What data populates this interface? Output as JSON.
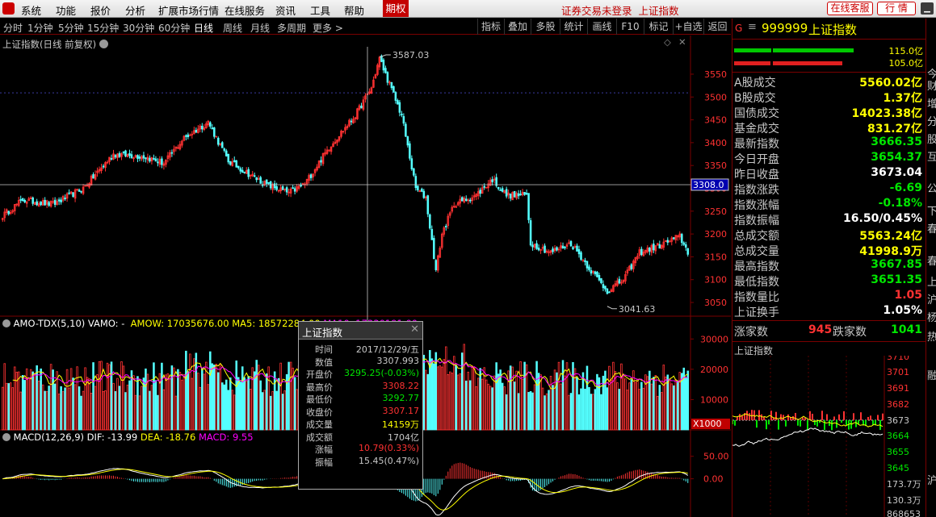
{
  "menu": {
    "items": [
      "系统",
      "功能",
      "报价",
      "分析",
      "扩展市场行情",
      "在线服务",
      "资讯",
      "工具",
      "帮助"
    ],
    "qihuo_tab": "期权",
    "login_status": "证券交易未登录",
    "current_index": "上证指数",
    "online_service_button": "在线客服",
    "quote_button": "行 情"
  },
  "periods": [
    "分时",
    "1分钟",
    "5分钟",
    "15分钟",
    "30分钟",
    "60分钟",
    "日线",
    "周线",
    "月线",
    "多周期",
    "更多"
  ],
  "active_period": "日线",
  "tools": [
    "指标",
    "叠加",
    "多股",
    "统计",
    "画线",
    "F10",
    "标记",
    "+自选",
    "返回"
  ],
  "main_panel": {
    "title": "上证指数(日线 前复权)",
    "high_label": "3587.03",
    "low_label": "3041.63",
    "crosshair_value": "3308.0"
  },
  "volume_panel": {
    "title": "AMO-TDX(5,10)",
    "vamo": "VAMO: -",
    "amow": "AMOW: 17035676.00",
    "ma5": "MA5: 18572284.00",
    "ma10": "MA10: 17330191.00",
    "unit": "X1000"
  },
  "macd_panel": {
    "title": "MACD(12,26,9)",
    "dif": "DIF: -13.99",
    "dea": "DEA: -18.76",
    "macd": "MACD: 9.55"
  },
  "tooltip": {
    "title": "上证指数",
    "rows": [
      {
        "k": "时间",
        "v": "2017/12/29/五",
        "c": "#c8c8c8"
      },
      {
        "k": "数值",
        "v": "3307.993",
        "c": "#c8c8c8"
      },
      {
        "k": "开盘价",
        "v": "3295.25(-0.03%)",
        "c": "#00e600"
      },
      {
        "k": "最高价",
        "v": "3308.22",
        "c": "#ff3232"
      },
      {
        "k": "最低价",
        "v": "3292.77",
        "c": "#00e600"
      },
      {
        "k": "收盘价",
        "v": "3307.17",
        "c": "#ff3232"
      },
      {
        "k": "成交量",
        "v": "14159万",
        "c": "#ffff00"
      },
      {
        "k": "成交额",
        "v": "1704亿",
        "c": "#c8c8c8"
      },
      {
        "k": "涨幅",
        "v": "10.79(0.33%)",
        "c": "#ff3232"
      },
      {
        "k": "振幅",
        "v": "15.45(0.47%)",
        "c": "#c8c8c8"
      }
    ]
  },
  "quote": {
    "code": "999999",
    "name": "上证指数",
    "bar1_value": "115.0亿",
    "bar2_value": "105.0亿",
    "rows": [
      {
        "k": "A股成交",
        "v": "5560.02亿",
        "c": "#ffff00"
      },
      {
        "k": "B股成交",
        "v": "1.37亿",
        "c": "#ffff00"
      },
      {
        "k": "国债成交",
        "v": "14023.38亿",
        "c": "#ffff00"
      },
      {
        "k": "基金成交",
        "v": "831.27亿",
        "c": "#ffff00"
      },
      {
        "k": "最新指数",
        "v": "3666.35",
        "c": "#00e600"
      },
      {
        "k": "今日开盘",
        "v": "3654.37",
        "c": "#00e600"
      },
      {
        "k": "昨日收盘",
        "v": "3673.04",
        "c": "#ffffff"
      },
      {
        "k": "指数涨跌",
        "v": "-6.69",
        "c": "#00e600"
      },
      {
        "k": "指数涨幅",
        "v": "-0.18%",
        "c": "#00e600"
      },
      {
        "k": "指数振幅",
        "v": "16.50/0.45%",
        "c": "#ffffff"
      },
      {
        "k": "总成交额",
        "v": "5563.24亿",
        "c": "#ffff00"
      },
      {
        "k": "总成交量",
        "v": "41998.9万",
        "c": "#ffff00"
      },
      {
        "k": "最高指数",
        "v": "3667.85",
        "c": "#00e600"
      },
      {
        "k": "最低指数",
        "v": "3651.35",
        "c": "#00e600"
      },
      {
        "k": "指数量比",
        "v": "1.05",
        "c": "#ff3232"
      },
      {
        "k": "上证换手",
        "v": "1.05%",
        "c": "#ffffff"
      }
    ],
    "rise_label": "涨家数",
    "rise_count": "945",
    "fall_label": "跌家数",
    "fall_count": "1041",
    "mini_title": "上证指数",
    "mini_axis": [
      "3710",
      "3701",
      "3691",
      "3682",
      "3673",
      "3664",
      "3655",
      "3645",
      "173.7万",
      "130.3万",
      "868653"
    ]
  },
  "edge_glyphs": [
    "今",
    "财",
    "增",
    "分",
    "股",
    "互",
    "公",
    "下",
    "春",
    "春",
    "上",
    "沪",
    "杨",
    "热",
    "融",
    "沪"
  ],
  "chart_data": [
    {
      "type": "candlestick",
      "title": "上证指数(日线 前复权)",
      "y_ticks": [
        3550,
        3500,
        3450,
        3400,
        3350,
        3300,
        3250,
        3200,
        3150,
        3100,
        3050
      ],
      "ylim": [
        3020,
        3610
      ],
      "annotations": {
        "high": 3587.03,
        "low": 3041.63,
        "crosshair": 3308.0
      },
      "anchors": [
        [
          0,
          3240
        ],
        [
          10,
          3275
        ],
        [
          25,
          3265
        ],
        [
          40,
          3300
        ],
        [
          55,
          3375
        ],
        [
          70,
          3370
        ],
        [
          80,
          3355
        ],
        [
          90,
          3410
        ],
        [
          102,
          3445
        ],
        [
          112,
          3360
        ],
        [
          130,
          3310
        ],
        [
          142,
          3290
        ],
        [
          150,
          3310
        ],
        [
          162,
          3390
        ],
        [
          175,
          3460
        ],
        [
          183,
          3520
        ],
        [
          187,
          3585
        ],
        [
          190,
          3550
        ],
        [
          198,
          3460
        ],
        [
          205,
          3300
        ],
        [
          210,
          3280
        ],
        [
          215,
          3120
        ],
        [
          218,
          3200
        ],
        [
          224,
          3265
        ],
        [
          235,
          3285
        ],
        [
          243,
          3320
        ],
        [
          250,
          3285
        ],
        [
          260,
          3285
        ],
        [
          262,
          3180
        ],
        [
          272,
          3160
        ],
        [
          282,
          3180
        ],
        [
          292,
          3120
        ],
        [
          300,
          3075
        ],
        [
          308,
          3100
        ],
        [
          316,
          3160
        ],
        [
          326,
          3175
        ],
        [
          336,
          3195
        ],
        [
          340,
          3160
        ]
      ],
      "count": 341
    },
    {
      "type": "bar",
      "title": "AMO-TDX(5,10)",
      "y_ticks": [
        30000,
        20000,
        10000
      ],
      "ylim": [
        0,
        33000
      ],
      "unit": "X1000",
      "series": [
        {
          "name": "AMOW"
        },
        {
          "name": "MA5"
        },
        {
          "name": "MA10"
        }
      ]
    },
    {
      "type": "bar",
      "title": "MACD(12,26,9)",
      "y_ticks": [
        50.0,
        0.0
      ],
      "ylim": [
        -85,
        80
      ],
      "series": [
        {
          "name": "DIF"
        },
        {
          "name": "DEA"
        },
        {
          "name": "MACD"
        }
      ]
    }
  ]
}
